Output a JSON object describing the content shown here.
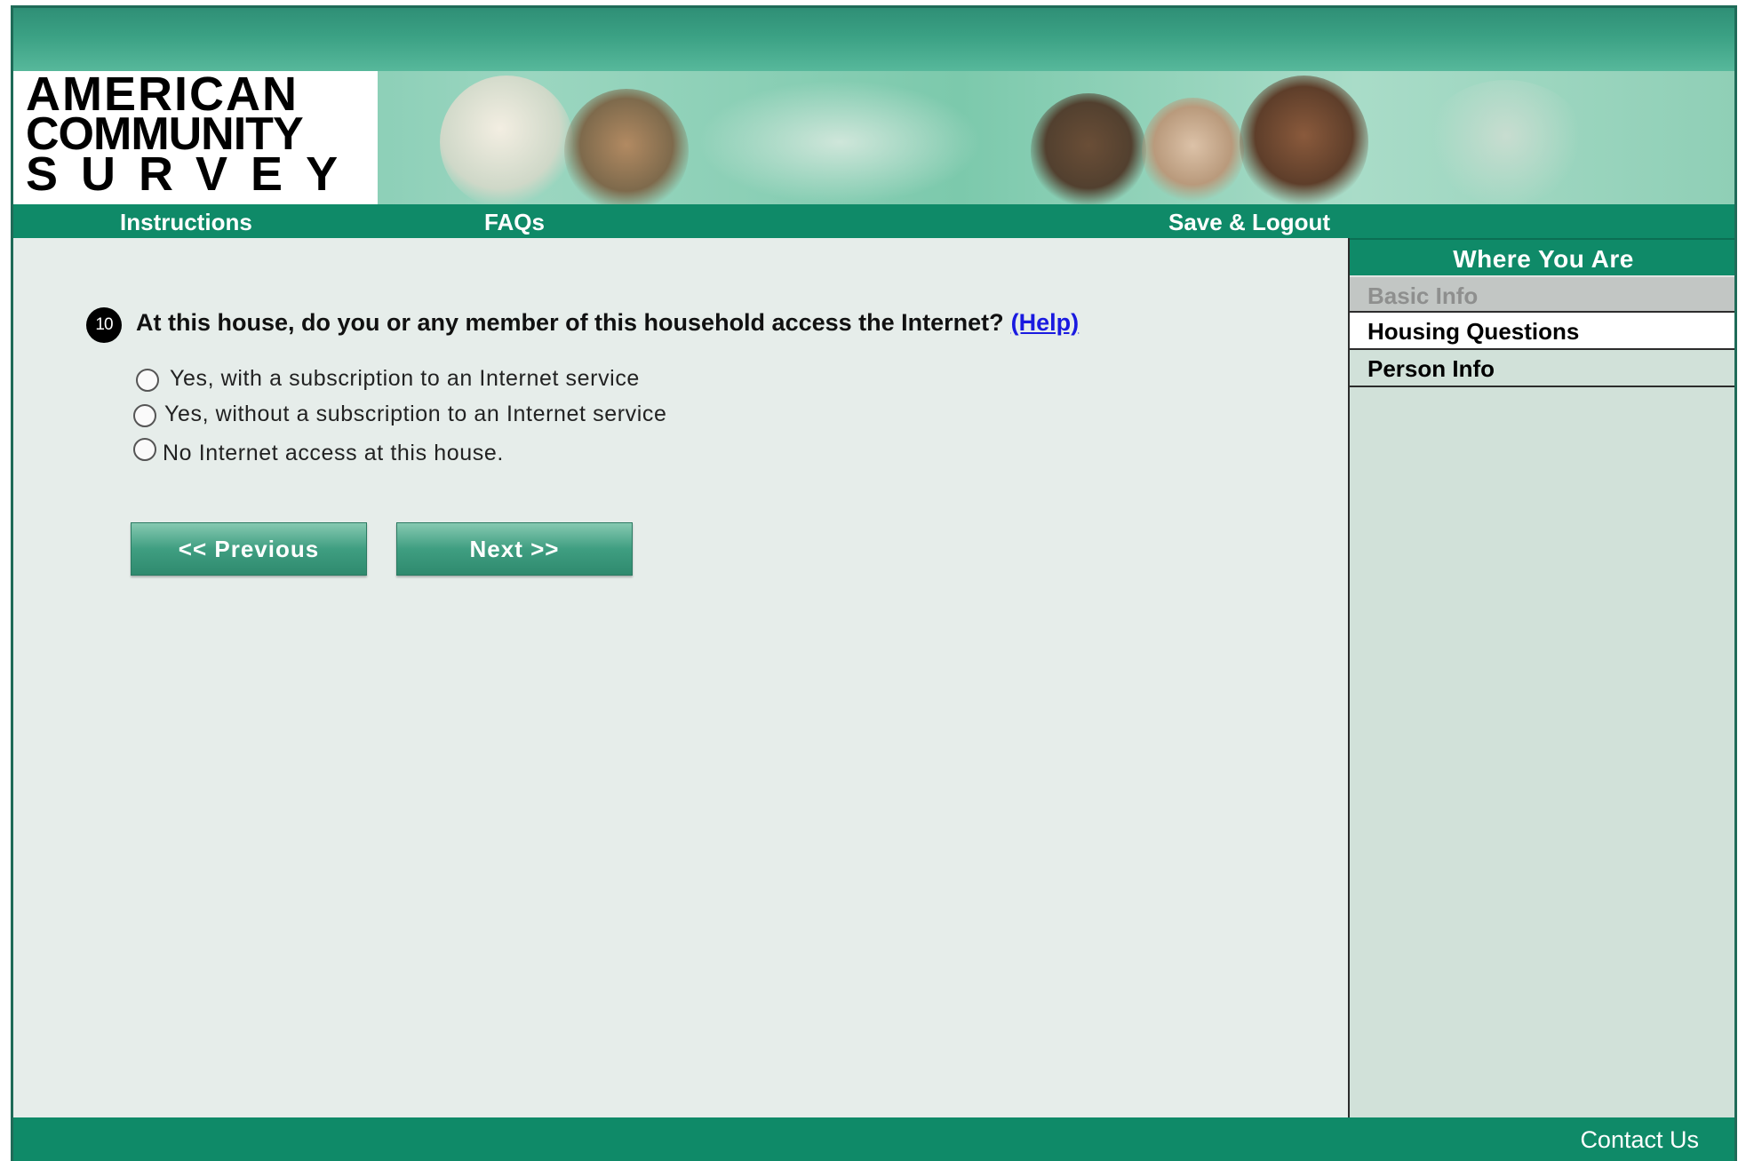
{
  "logo": {
    "line1": "AMERICAN",
    "line2": "COMMUNITY",
    "line3": "SURVEY"
  },
  "nav": {
    "instructions": "Instructions",
    "faqs": "FAQs",
    "save_logout": "Save & Logout"
  },
  "question": {
    "number": "10",
    "text": "At this house, do you or any member of this household access the Internet?",
    "help": "(Help)"
  },
  "options": [
    {
      "label": "Yes, with a subscription to an Internet service",
      "selected": false
    },
    {
      "label": "Yes, without a subscription to an Internet service",
      "selected": false
    },
    {
      "label": "No Internet access at this house.",
      "selected": false
    }
  ],
  "buttons": {
    "previous": "<<   Previous",
    "next": "Next   >>"
  },
  "sidebar": {
    "header": "Where You Are",
    "items": [
      {
        "label": "Basic Info",
        "state": "disabled"
      },
      {
        "label": "Housing Questions",
        "state": "current"
      },
      {
        "label": "Person Info",
        "state": "normal"
      }
    ]
  },
  "footer": {
    "contact": "Contact Us"
  },
  "colors": {
    "nav_green": "#0f8a68",
    "page_bg": "#e6edea",
    "sidebar_bg": "#d1e1d9",
    "help_link": "#1a1ae0"
  }
}
